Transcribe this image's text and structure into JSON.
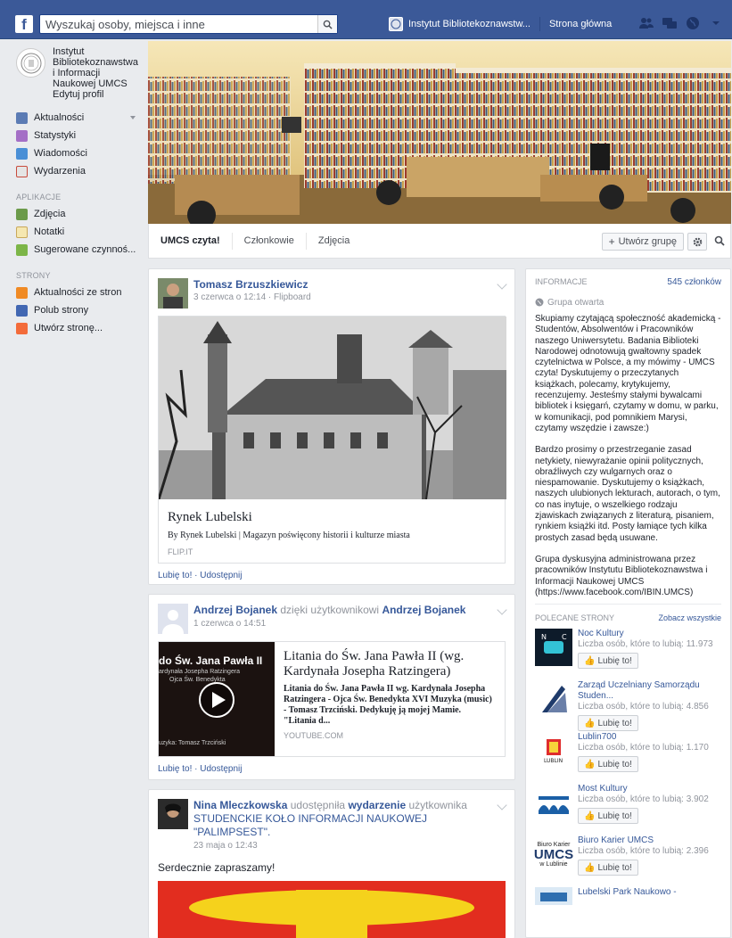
{
  "topbar": {
    "search_placeholder": "Wyszukaj osoby, miejsca i inne",
    "profile_link": "Instytut Bibliotekoznawstw...",
    "home_link": "Strona główna"
  },
  "sidebar": {
    "profile_name": "Instytut Bibliotekoznawstwa i Informacji Naukowej UMCS",
    "edit_profile": "Edytuj profil",
    "main_items": [
      {
        "label": "Aktualności"
      },
      {
        "label": "Statystyki"
      },
      {
        "label": "Wiadomości"
      },
      {
        "label": "Wydarzenia"
      }
    ],
    "apps_header": "APLIKACJE",
    "app_items": [
      {
        "label": "Zdjęcia"
      },
      {
        "label": "Notatki"
      },
      {
        "label": "Sugerowane czynnoś..."
      }
    ],
    "pages_header": "STRONY",
    "page_items": [
      {
        "label": "Aktualności ze stron"
      },
      {
        "label": "Polub strony"
      },
      {
        "label": "Utwórz stronę..."
      }
    ]
  },
  "group_tabs": {
    "items": [
      "UMCS czyta!",
      "Członkowie",
      "Zdjęcia"
    ],
    "create_group": "Utwórz grupę"
  },
  "posts": [
    {
      "author": "Tomasz Brzuszkiewicz",
      "meta": "3 czerwca o 12:14 · Flipboard",
      "share_title": "Rynek Lubelski",
      "share_desc": "By Rynek Lubelski | Magazyn poświęcony historii i kulturze miasta",
      "share_src": "FLIP.IT",
      "actions": "Lubię to! · Udostępnij"
    },
    {
      "author": "Andrzej Bojanek",
      "via": "dzięki użytkownikowi",
      "via_author": "Andrzej Bojanek",
      "meta": "1 czerwca o 14:51",
      "share_title": "Litania do Św. Jana Pawła II (wg. Kardynała Josepha Ratzingera)",
      "share_desc": "Litania do Św. Jana Pawła II wg. Kardynała Josepha Ratzingera - Ojca Św. Benedykta XVI Muzyka (music) - Tomasz Trzciński. Dedykuję ją mojej Mamie. \"Litania d...",
      "share_src": "YOUTUBE.COM",
      "thumb_title": "do Św. Jana Pawła II",
      "thumb_sub1": "ardynała Josepha Ratzingera",
      "thumb_sub2": "Ojca Św. Benedykta",
      "thumb_credit": "uzyka: Tomasz Trzciński",
      "actions": "Lubię to! · Udostępnij"
    },
    {
      "author": "Nina Mleczkowska",
      "shares": "udostępniła",
      "event_word": "wydarzenie",
      "user_word": "użytkownika",
      "event_name": "STUDENCKIE KOŁO INFORMACJI NAUKOWEJ \"PALIMPSEST\".",
      "meta": "23 maja o 12:43",
      "body": "Serdecznie zapraszamy!"
    }
  ],
  "info": {
    "header": "INFORMACJE",
    "members": "545 członków",
    "group_type": "Grupa otwarta",
    "paragraphs": [
      "Skupiamy czytającą społeczność akademicką - Studentów, Absolwentów i Pracowników naszego Uniwersytetu. Badania Biblioteki Narodowej odnotowują gwałtowny spadek czytelnictwa w Polsce, a my mówimy - UMCS czyta! Dyskutujemy o przeczytanych książkach, polecamy, krytykujemy, recenzujemy. Jesteśmy stałymi bywalcami bibliotek i księgarń, czytamy w domu, w parku, w komunikacji, pod pomnikiem Marysi, czytamy wszędzie i zawsze:)",
      "Bardzo prosimy o przestrzeganie zasad netykiety, niewyrażanie opinii politycznych, obraźliwych czy wulgarnych oraz o niespamowanie. Dyskutujemy o książkach, naszych ulubionych lekturach, autorach, o tym, co nas inytuje, o wszelkiego rodzaju zjawiskach związanych z literaturą, pisaniem, rynkiem książki itd. Posty łamiące tych kilka prostych zasad będą usuwane.",
      "Grupa dyskusyjna administrowana przez pracowników Instytutu Bibliotekoznawstwa i Informacji Naukowej UMCS (https://www.facebook.com/IBIN.UMCS)"
    ],
    "recommended_header": "POLECANE STRONY",
    "see_all": "Zobacz wszystkie",
    "like_label": "Lubię to!",
    "pages": [
      {
        "name": "Noc Kultury",
        "likes": "Liczba osób, które to lubią: 11.973"
      },
      {
        "name": "Zarząd Uczelniany Samorządu Studen...",
        "likes": "Liczba osób, które to lubią: 4.856"
      },
      {
        "name": "Lublin700",
        "likes": "Liczba osób, które to lubią: 1.170",
        "logo_text": "LUBLIN"
      },
      {
        "name": "Most Kultury",
        "likes": "Liczba osób, które to lubią: 3.902"
      },
      {
        "name": "Biuro Karier UMCS",
        "likes": "Liczba osób, które to lubią: 2.396",
        "logo_top": "Biuro Karier",
        "logo_mid": "UMCS",
        "logo_bot": "w Lublinie"
      },
      {
        "name": "Lubelski Park Naukowo -",
        "likes": ""
      }
    ]
  }
}
